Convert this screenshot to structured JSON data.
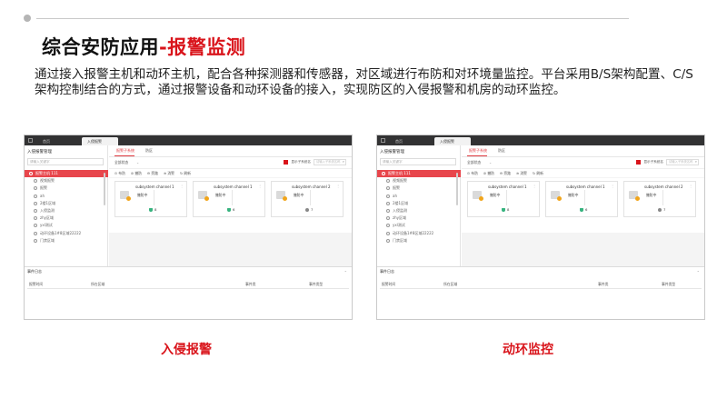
{
  "slide": {
    "title_main": "综合安防应用",
    "title_accent": "-报警监测",
    "intro": "通过接入报警主机和动环主机，配合各种探测器和传感器，对区域进行布防和对环境量监控。平台采用B/S架构配置、C/S架构控制结合的方式，通过报警设备和动环设备的接入，实现防区的入侵报警和机房的动环监控。"
  },
  "colors": {
    "accent": "#d9141b",
    "titlebar": "#323233",
    "selected": "#e8464c",
    "shield": "#36b37e",
    "alarm_dot": "#f1a51b"
  },
  "panels": [
    {
      "caption": "入侵报警",
      "tabs": [
        "首页",
        "入侵报警"
      ],
      "left_title": "入侵报警管理",
      "search_placeholder": "请输入关键字",
      "tree": [
        {
          "label": "报警主机 111",
          "selected": true
        },
        {
          "label": "视频报警",
          "selected": false
        },
        {
          "label": "报警",
          "selected": false
        },
        {
          "label": "ah",
          "selected": false
        },
        {
          "label": "2楼1区域",
          "selected": false
        },
        {
          "label": "入侵监测",
          "selected": false
        },
        {
          "label": "zhy区域",
          "selected": false
        },
        {
          "label": "yxl测试",
          "selected": false
        },
        {
          "label": "动环设备1#8区域22222",
          "selected": false
        },
        {
          "label": "门禁区域",
          "selected": false
        }
      ],
      "subtabs": [
        "报警子系统",
        "防区"
      ],
      "filter_select": "全部状态",
      "filter_checkbox_label": "显示子系统名",
      "filter_search_placeholder": "请输入子系统名称",
      "tools": [
        "布防",
        "撤防",
        "旁路",
        "消警",
        "刷新"
      ],
      "cards": [
        {
          "name": "subsystem channel 1",
          "status": "撤防中",
          "count_label": "8",
          "icon": "shield"
        },
        {
          "name": "subsystem channel 1",
          "status": "撤防中",
          "count_label": "6",
          "icon": "shield"
        },
        {
          "name": "subsystem channel 2",
          "status": "撤防中",
          "count_label": "7",
          "icon": "bell"
        }
      ],
      "events_title": "事件日志",
      "event_columns": [
        "报警时间",
        "所在区域",
        "事件类",
        "事件类型"
      ]
    },
    {
      "caption": "动环监控",
      "tabs": [
        "首页",
        "入侵报警"
      ],
      "left_title": "入侵报警管理",
      "search_placeholder": "请输入关键字",
      "tree": [
        {
          "label": "报警主机 111",
          "selected": true
        },
        {
          "label": "视频报警",
          "selected": false
        },
        {
          "label": "报警",
          "selected": false
        },
        {
          "label": "ah",
          "selected": false
        },
        {
          "label": "2楼1区域",
          "selected": false
        },
        {
          "label": "入侵监测",
          "selected": false
        },
        {
          "label": "zhy区域",
          "selected": false
        },
        {
          "label": "yxl测试",
          "selected": false
        },
        {
          "label": "动环设备1#8区域22222",
          "selected": false
        },
        {
          "label": "门禁区域",
          "selected": false
        }
      ],
      "subtabs": [
        "报警子系统",
        "防区"
      ],
      "filter_select": "全部状态",
      "filter_checkbox_label": "显示子系统名",
      "filter_search_placeholder": "请输入子系统名称",
      "tools": [
        "布防",
        "撤防",
        "旁路",
        "消警",
        "刷新"
      ],
      "cards": [
        {
          "name": "subsystem channel 1",
          "status": "撤防中",
          "count_label": "8",
          "icon": "shield"
        },
        {
          "name": "subsystem channel 1",
          "status": "撤防中",
          "count_label": "6",
          "icon": "shield"
        },
        {
          "name": "subsystem channel 2",
          "status": "撤防中",
          "count_label": "7",
          "icon": "bell"
        }
      ],
      "events_title": "事件日志",
      "event_columns": [
        "报警时间",
        "所在区域",
        "事件类",
        "事件类型"
      ]
    }
  ]
}
